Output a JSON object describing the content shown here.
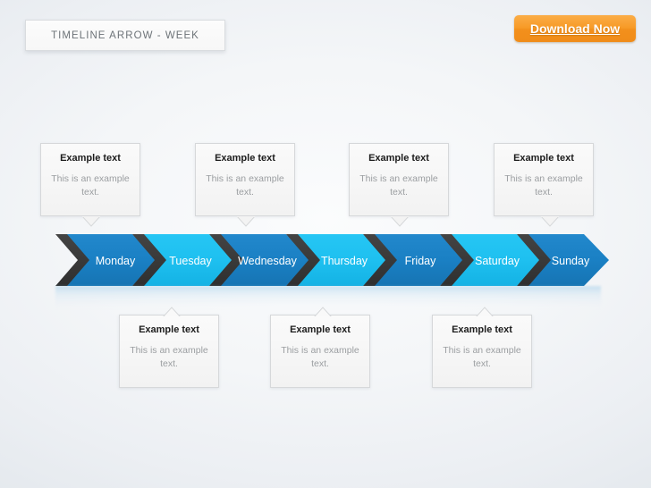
{
  "title_plate": {
    "label": "TIMELINE ARROW - WEEK"
  },
  "download": {
    "label": "Download Now",
    "color": "#f59324"
  },
  "colors": {
    "blue_dark": "#1a80c4",
    "blue_light": "#1ec0f0",
    "shadow_dark": "#3a3a3a",
    "gap_white": "#ffffff",
    "background": "#f2f5f8",
    "day_label": "#ffffff",
    "callout_heading": "#1c1c1c",
    "callout_body": "#9b9ea1",
    "callout_border": "#d6d8da",
    "title_text": "#6d7378"
  },
  "timeline": {
    "segments": [
      {
        "day": "Monday",
        "color": "#1a80c4"
      },
      {
        "day": "Tuesday",
        "color": "#1ec0f0"
      },
      {
        "day": "Wednesday",
        "color": "#1a80c4"
      },
      {
        "day": "Thursday",
        "color": "#1ec0f0"
      },
      {
        "day": "Friday",
        "color": "#1a80c4"
      },
      {
        "day": "Saturday",
        "color": "#1ec0f0"
      },
      {
        "day": "Sunday",
        "color": "#1a80c4"
      }
    ]
  },
  "callouts_top": [
    {
      "heading": "Example text",
      "body": "This is an example text."
    },
    {
      "heading": "Example text",
      "body": "This is an example text."
    },
    {
      "heading": "Example text",
      "body": "This is an example text."
    },
    {
      "heading": "Example text",
      "body": "This is an example text."
    }
  ],
  "callouts_bottom": [
    {
      "heading": "Example text",
      "body": "This is an example text."
    },
    {
      "heading": "Example text",
      "body": "This is an example text."
    },
    {
      "heading": "Example text",
      "body": "This is an example text."
    }
  ]
}
